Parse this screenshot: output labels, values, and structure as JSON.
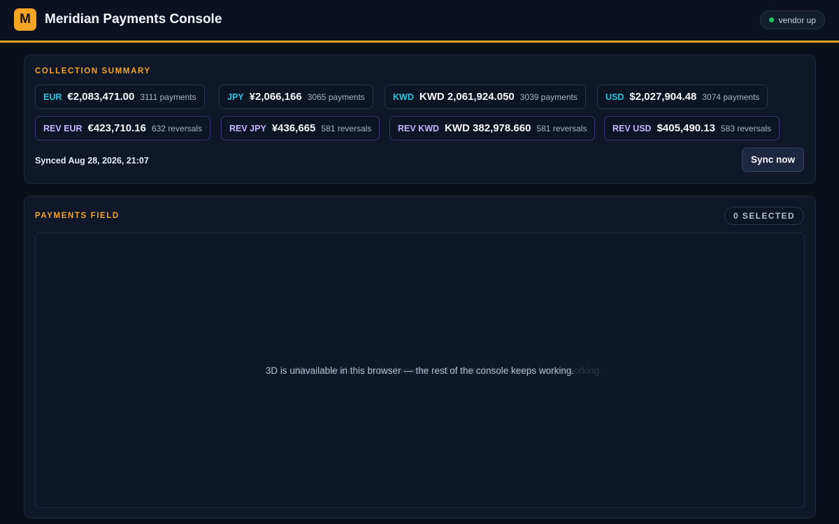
{
  "header": {
    "logo_letter": "M",
    "title": "Meridian Payments Console",
    "vendor_status": "vendor up"
  },
  "summary": {
    "label": "COLLECTION SUMMARY",
    "payments": [
      {
        "code": "EUR",
        "amount": "€2,083,471.00",
        "count": "3111 payments"
      },
      {
        "code": "JPY",
        "amount": "¥2,066,166",
        "count": "3065 payments"
      },
      {
        "code": "KWD",
        "amount": "KWD 2,061,924.050",
        "count": "3039 payments"
      },
      {
        "code": "USD",
        "amount": "$2,027,904.48",
        "count": "3074 payments"
      }
    ],
    "reversals": [
      {
        "code": "REV EUR",
        "amount": "€423,710.16",
        "count": "632 reversals"
      },
      {
        "code": "REV JPY",
        "amount": "¥436,665",
        "count": "581 reversals"
      },
      {
        "code": "REV KWD",
        "amount": "KWD 382,978.660",
        "count": "581 reversals"
      },
      {
        "code": "REV USD",
        "amount": "$405,490.13",
        "count": "583 reversals"
      }
    ],
    "synced_text": "Synced Aug 28, 2026, 21:07",
    "sync_button": "Sync now"
  },
  "field": {
    "label": "PAYMENTS FIELD",
    "selected": "0 SELECTED",
    "fallback_message": "3D is unavailable in this browser — the rest of the console keeps working."
  },
  "colors": {
    "accent": "#f5a524",
    "status_up": "#22c55e",
    "payment_code": "#22c6e0",
    "reversal_code": "#c4b5fd"
  }
}
